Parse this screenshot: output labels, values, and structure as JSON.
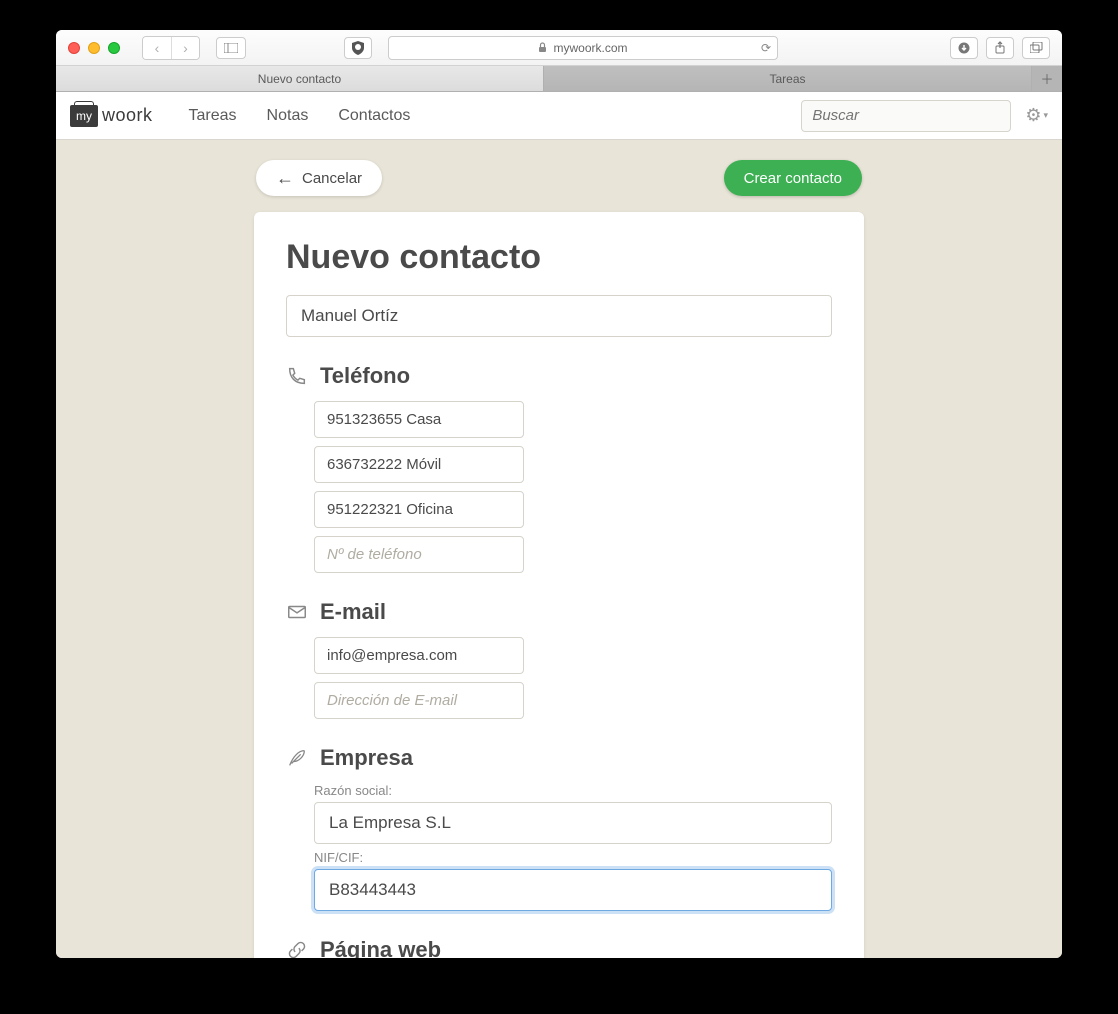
{
  "browser": {
    "url": "mywoork.com",
    "tabs": [
      "Nuevo contacto",
      "Tareas"
    ]
  },
  "navbar": {
    "logo_my": "my",
    "logo_rest": "woork",
    "links": {
      "tareas": "Tareas",
      "notas": "Notas",
      "contactos": "Contactos"
    },
    "search_placeholder": "Buscar"
  },
  "actions": {
    "cancel": "Cancelar",
    "create": "Crear contacto"
  },
  "form": {
    "title": "Nuevo contacto",
    "name_value": "Manuel Ortíz",
    "phone": {
      "heading": "Teléfono",
      "items": [
        "951323655 Casa",
        "636732222 Móvil",
        "951222321 Oficina"
      ],
      "placeholder": "Nº de teléfono"
    },
    "email": {
      "heading": "E-mail",
      "items": [
        "info@empresa.com"
      ],
      "placeholder": "Dirección de E-mail"
    },
    "company": {
      "heading": "Empresa",
      "razon_label": "Razón social:",
      "razon_value": "La Empresa S.L",
      "nif_label": "NIF/CIF:",
      "nif_value": "B83443443"
    },
    "web": {
      "heading": "Página web"
    }
  }
}
